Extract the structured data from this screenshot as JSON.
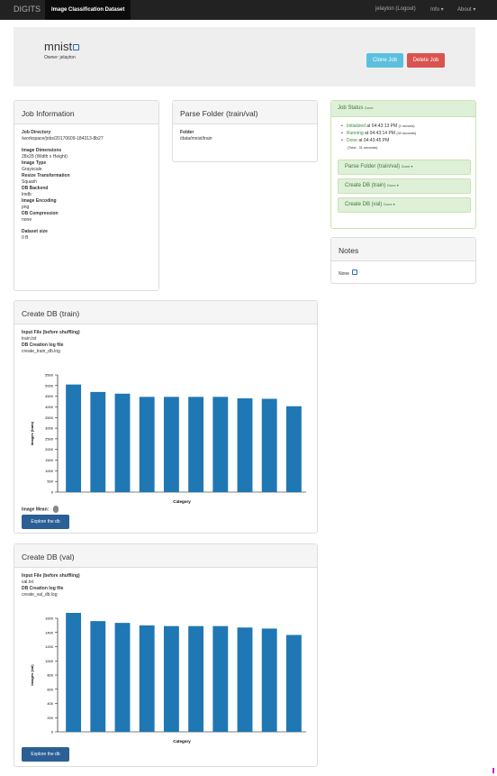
{
  "navbar": {
    "brand": "DIGITS",
    "active_tab": "Image Classification Dataset",
    "user_link": "jelayton (Logout)",
    "info_menu": "Info ▾",
    "about_menu": "About ▾"
  },
  "header": {
    "job_name": "mnist",
    "owner": "Owner: jelayton",
    "clone_label": "Clone Job",
    "delete_label": "Delete Job"
  },
  "job_info": {
    "title": "Job Information",
    "fields": [
      {
        "label": "Job Directory",
        "value": "/workspace/jobs/20170609-184313-8b27"
      },
      {
        "label": "Image Dimensions",
        "value": "28x28 (Width x Height)"
      },
      {
        "label": "Image Type",
        "value": "Grayscale"
      },
      {
        "label": "Resize Transformation",
        "value": "Squash"
      },
      {
        "label": "DB Backend",
        "value": "lmdb"
      },
      {
        "label": "Image Encoding",
        "value": "png"
      },
      {
        "label": "DB Compression",
        "value": "none"
      },
      {
        "label": "Dataset size",
        "value": "0 B"
      }
    ]
  },
  "parse_folder": {
    "title": "Parse Folder (train/val)",
    "folder_label": "Folder",
    "folder_value": "/data/mnist/train"
  },
  "job_status": {
    "title": "Job Status",
    "title_badge": "Done",
    "events": [
      {
        "state": "Initialized",
        "time": "at 04:43:13 PM",
        "duration": "(1 second)"
      },
      {
        "state": "Running",
        "time": "at 04:43:14 PM",
        "duration": "(30 seconds)"
      },
      {
        "state": "Done",
        "time": "at 04:43:45 PM",
        "duration": ""
      }
    ],
    "total": "(Total - 31 seconds)",
    "subtasks": [
      {
        "label": "Parse Folder (train/val)",
        "badge": "Done ▾"
      },
      {
        "label": "Create DB (train)",
        "badge": "Done ▾"
      },
      {
        "label": "Create DB (val)",
        "badge": "Done ▾"
      }
    ]
  },
  "notes": {
    "title": "Notes",
    "value": "None"
  },
  "create_db_train": {
    "title": "Create DB (train)",
    "input_label": "Input File (before shuffling)",
    "input_link": "train.txt",
    "log_label": "DB Creation log file",
    "log_link": "create_train_db.log",
    "image_mean_label": "Image Mean:",
    "explore_label": "Explore the db"
  },
  "create_db_val": {
    "title": "Create DB (val)",
    "input_label": "Input File (before shuffling)",
    "input_link": "val.txt",
    "log_label": "DB Creation log file",
    "log_link": "create_val_db.log",
    "explore_label": "Explore the db"
  },
  "chart_data": [
    {
      "type": "bar",
      "categories": [
        "0",
        "1",
        "2",
        "3",
        "4",
        "5",
        "6",
        "7",
        "8",
        "9"
      ],
      "values": [
        5050,
        4700,
        4620,
        4470,
        4470,
        4470,
        4470,
        4400,
        4380,
        4030
      ],
      "xlabel": "Category",
      "ylabel": "Images (train)",
      "ylim": [
        0,
        5500
      ],
      "yticks": [
        0,
        500,
        1000,
        1500,
        2000,
        2500,
        3000,
        3500,
        4000,
        4500,
        5000,
        5500
      ],
      "color": "#1f77b4",
      "grid": false
    },
    {
      "type": "bar",
      "categories": [
        "0",
        "1",
        "2",
        "3",
        "4",
        "5",
        "6",
        "7",
        "8",
        "9"
      ],
      "values": [
        1680,
        1560,
        1535,
        1500,
        1490,
        1490,
        1490,
        1470,
        1455,
        1365
      ],
      "xlabel": "Category",
      "ylabel": "Images (val)",
      "ylim": [
        0,
        1600
      ],
      "yticks": [
        0,
        200,
        400,
        600,
        800,
        1000,
        1200,
        1400,
        1600
      ],
      "color": "#1f77b4",
      "grid": false
    }
  ]
}
